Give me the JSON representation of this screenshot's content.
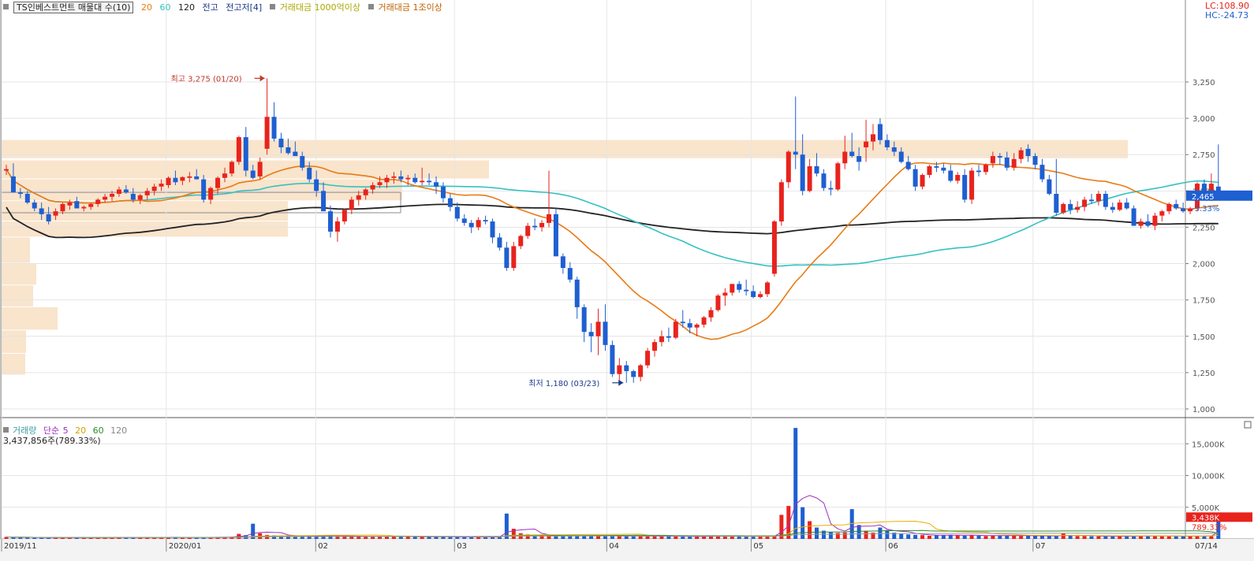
{
  "header": {
    "title": "TS인베스트먼트 매물대 수(10)",
    "ma_periods": [
      "20",
      "60",
      "120"
    ],
    "ma_colors": [
      "#e87b16",
      "#36c1c1",
      "#222222"
    ],
    "item_jeongo": "전고",
    "item_jeongojeo": "전고저[4]",
    "item_volume_1000": "거래대금 1000억이상",
    "item_volume_1jo": "거래대금 1조이상"
  },
  "corner": {
    "lc": "LC:108.90",
    "hc": "HC:-24.73"
  },
  "price_tag": {
    "value": "2,465",
    "change": "-3.33%"
  },
  "volume_tag": {
    "value": "3,438K",
    "change": "789.33%"
  },
  "annotations": {
    "high": "최고 3,275 (01/20)",
    "low": "최저 1,180 (03/23)"
  },
  "volume_legend": {
    "label": "거래량",
    "ma_type": "단순",
    "periods": [
      "5",
      "20",
      "60",
      "120"
    ],
    "current": "3,437,856주(789.33%)"
  },
  "colors": {
    "up": "#e8231d",
    "down": "#1e5fd1",
    "ma20": "#e87b16",
    "ma60": "#36c1c1",
    "ma120": "#222222",
    "zone": "#f9e4cc"
  },
  "chart_data": [
    {
      "type": "candlestick",
      "title": "TS인베스트먼트",
      "ylim": [
        1000,
        3400
      ],
      "y_ticks": [
        "3,250",
        "3,000",
        "2,750",
        "2,500",
        "2,250",
        "2,000",
        "1,750",
        "1,500",
        "1,250",
        "1,000"
      ],
      "x_ticks": [
        "2019/11",
        "2020/01",
        "02",
        "03",
        "04",
        "05",
        "06",
        "07",
        "07/14"
      ],
      "candles": [
        [
          2640,
          2680,
          2610,
          2650
        ],
        [
          2600,
          2690,
          2560,
          2490
        ],
        [
          2490,
          2520,
          2450,
          2480
        ],
        [
          2480,
          2500,
          2410,
          2420
        ],
        [
          2420,
          2440,
          2360,
          2380
        ],
        [
          2380,
          2420,
          2300,
          2340
        ],
        [
          2340,
          2390,
          2270,
          2290
        ],
        [
          2330,
          2380,
          2300,
          2360
        ],
        [
          2360,
          2420,
          2340,
          2410
        ],
        [
          2400,
          2440,
          2370,
          2420
        ],
        [
          2430,
          2460,
          2400,
          2380
        ],
        [
          2380,
          2400,
          2360,
          2390
        ],
        [
          2390,
          2420,
          2370,
          2410
        ],
        [
          2410,
          2450,
          2390,
          2440
        ],
        [
          2440,
          2480,
          2420,
          2460
        ],
        [
          2460,
          2500,
          2430,
          2480
        ],
        [
          2480,
          2530,
          2460,
          2510
        ],
        [
          2510,
          2540,
          2480,
          2490
        ],
        [
          2480,
          2520,
          2420,
          2440
        ],
        [
          2440,
          2480,
          2410,
          2470
        ],
        [
          2470,
          2520,
          2440,
          2500
        ],
        [
          2500,
          2550,
          2470,
          2530
        ],
        [
          2530,
          2580,
          2500,
          2550
        ],
        [
          2540,
          2600,
          2520,
          2590
        ],
        [
          2590,
          2640,
          2540,
          2560
        ],
        [
          2570,
          2600,
          2540,
          2595
        ],
        [
          2590,
          2630,
          2560,
          2600
        ],
        [
          2600,
          2650,
          2580,
          2580
        ],
        [
          2580,
          2610,
          2420,
          2440
        ],
        [
          2440,
          2530,
          2410,
          2520
        ],
        [
          2520,
          2600,
          2480,
          2590
        ],
        [
          2590,
          2660,
          2560,
          2620
        ],
        [
          2620,
          2710,
          2600,
          2700
        ],
        [
          2700,
          2880,
          2680,
          2870
        ],
        [
          2870,
          2940,
          2600,
          2640
        ],
        [
          2640,
          2680,
          2580,
          2590
        ],
        [
          2600,
          2730,
          2580,
          2700
        ],
        [
          2790,
          3275,
          2750,
          3010
        ],
        [
          3010,
          3110,
          2840,
          2860
        ],
        [
          2860,
          2900,
          2760,
          2800
        ],
        [
          2800,
          2860,
          2750,
          2760
        ],
        [
          2770,
          2840,
          2750,
          2740
        ],
        [
          2740,
          2770,
          2640,
          2660
        ],
        [
          2660,
          2700,
          2560,
          2580
        ],
        [
          2580,
          2640,
          2460,
          2500
        ],
        [
          2500,
          2560,
          2400,
          2360
        ],
        [
          2360,
          2400,
          2180,
          2220
        ],
        [
          2220,
          2320,
          2150,
          2290
        ],
        [
          2290,
          2380,
          2270,
          2370
        ],
        [
          2370,
          2460,
          2340,
          2440
        ],
        [
          2440,
          2500,
          2400,
          2470
        ],
        [
          2470,
          2520,
          2440,
          2510
        ],
        [
          2510,
          2560,
          2480,
          2540
        ],
        [
          2540,
          2600,
          2520,
          2560
        ],
        [
          2560,
          2610,
          2520,
          2590
        ],
        [
          2590,
          2630,
          2550,
          2600
        ],
        [
          2600,
          2640,
          2560,
          2580
        ],
        [
          2580,
          2610,
          2540,
          2590
        ],
        [
          2590,
          2620,
          2550,
          2560
        ],
        [
          2560,
          2660,
          2540,
          2570
        ],
        [
          2570,
          2620,
          2540,
          2560
        ],
        [
          2560,
          2600,
          2480,
          2530
        ],
        [
          2530,
          2560,
          2420,
          2450
        ],
        [
          2450,
          2480,
          2360,
          2390
        ],
        [
          2390,
          2420,
          2290,
          2310
        ],
        [
          2310,
          2340,
          2260,
          2280
        ],
        [
          2280,
          2300,
          2210,
          2250
        ],
        [
          2250,
          2320,
          2230,
          2300
        ],
        [
          2300,
          2330,
          2270,
          2290
        ],
        [
          2290,
          2310,
          2140,
          2180
        ],
        [
          2180,
          2210,
          2090,
          2110
        ],
        [
          2110,
          2150,
          1950,
          1970
        ],
        [
          1970,
          2150,
          1950,
          2120
        ],
        [
          2120,
          2200,
          2100,
          2190
        ],
        [
          2190,
          2280,
          2170,
          2260
        ],
        [
          2260,
          2310,
          2230,
          2250
        ],
        [
          2250,
          2300,
          2220,
          2280
        ],
        [
          2280,
          2640,
          2250,
          2340
        ],
        [
          2340,
          2380,
          2060,
          2050
        ],
        [
          2050,
          2070,
          1930,
          1970
        ],
        [
          1970,
          2010,
          1870,
          1890
        ],
        [
          1890,
          1910,
          1620,
          1700
        ],
        [
          1700,
          1720,
          1460,
          1530
        ],
        [
          1530,
          1590,
          1390,
          1500
        ],
        [
          1500,
          1690,
          1370,
          1600
        ],
        [
          1600,
          1720,
          1400,
          1440
        ],
        [
          1440,
          1470,
          1220,
          1240
        ],
        [
          1240,
          1350,
          1200,
          1300
        ],
        [
          1300,
          1330,
          1180,
          1260
        ],
        [
          1260,
          1270,
          1180,
          1220
        ],
        [
          1220,
          1310,
          1190,
          1300
        ],
        [
          1300,
          1420,
          1280,
          1400
        ],
        [
          1400,
          1480,
          1360,
          1460
        ],
        [
          1460,
          1540,
          1430,
          1500
        ],
        [
          1500,
          1560,
          1460,
          1490
        ],
        [
          1490,
          1620,
          1480,
          1600
        ],
        [
          1600,
          1680,
          1560,
          1590
        ],
        [
          1590,
          1620,
          1520,
          1560
        ],
        [
          1560,
          1590,
          1500,
          1580
        ],
        [
          1580,
          1640,
          1560,
          1630
        ],
        [
          1630,
          1700,
          1600,
          1680
        ],
        [
          1680,
          1790,
          1670,
          1780
        ],
        [
          1780,
          1830,
          1710,
          1800
        ],
        [
          1800,
          1860,
          1780,
          1860
        ],
        [
          1860,
          1880,
          1800,
          1820
        ],
        [
          1820,
          1890,
          1780,
          1810
        ],
        [
          1810,
          1850,
          1760,
          1770
        ],
        [
          1770,
          1810,
          1760,
          1790
        ],
        [
          1790,
          1880,
          1770,
          1870
        ],
        [
          1930,
          2300,
          1910,
          2290
        ],
        [
          2290,
          2580,
          2260,
          2560
        ],
        [
          2560,
          2780,
          2520,
          2770
        ],
        [
          2770,
          3150,
          2650,
          2750
        ],
        [
          2750,
          2890,
          2470,
          2500
        ],
        [
          2500,
          2720,
          2490,
          2670
        ],
        [
          2670,
          2760,
          2600,
          2620
        ],
        [
          2620,
          2650,
          2500,
          2520
        ],
        [
          2520,
          2570,
          2470,
          2510
        ],
        [
          2510,
          2700,
          2500,
          2690
        ],
        [
          2690,
          2880,
          2650,
          2770
        ],
        [
          2770,
          2900,
          2730,
          2740
        ],
        [
          2740,
          2800,
          2640,
          2700
        ],
        [
          2800,
          2990,
          2700,
          2840
        ],
        [
          2840,
          2960,
          2780,
          2890
        ],
        [
          2960,
          3000,
          2820,
          2850
        ],
        [
          2850,
          2890,
          2780,
          2800
        ],
        [
          2800,
          2840,
          2740,
          2770
        ],
        [
          2770,
          2800,
          2690,
          2700
        ],
        [
          2700,
          2740,
          2640,
          2650
        ],
        [
          2650,
          2680,
          2500,
          2530
        ],
        [
          2530,
          2620,
          2510,
          2610
        ],
        [
          2610,
          2680,
          2590,
          2670
        ],
        [
          2670,
          2700,
          2630,
          2660
        ],
        [
          2660,
          2690,
          2620,
          2640
        ],
        [
          2640,
          2680,
          2560,
          2570
        ],
        [
          2570,
          2630,
          2550,
          2610
        ],
        [
          2610,
          2650,
          2420,
          2440
        ],
        [
          2440,
          2660,
          2410,
          2640
        ],
        [
          2640,
          2680,
          2600,
          2630
        ],
        [
          2630,
          2690,
          2610,
          2680
        ],
        [
          2690,
          2770,
          2660,
          2740
        ],
        [
          2740,
          2760,
          2680,
          2730
        ],
        [
          2730,
          2770,
          2640,
          2660
        ],
        [
          2660,
          2760,
          2640,
          2720
        ],
        [
          2720,
          2800,
          2690,
          2780
        ],
        [
          2790,
          2820,
          2700,
          2740
        ],
        [
          2740,
          2760,
          2650,
          2680
        ],
        [
          2680,
          2720,
          2560,
          2580
        ],
        [
          2580,
          2610,
          2470,
          2480
        ],
        [
          2480,
          2720,
          2330,
          2350
        ],
        [
          2350,
          2420,
          2340,
          2410
        ],
        [
          2410,
          2440,
          2340,
          2370
        ],
        [
          2370,
          2430,
          2350,
          2390
        ],
        [
          2390,
          2460,
          2360,
          2440
        ],
        [
          2440,
          2480,
          2410,
          2430
        ],
        [
          2430,
          2500,
          2400,
          2480
        ],
        [
          2480,
          2500,
          2370,
          2390
        ],
        [
          2390,
          2420,
          2350,
          2370
        ],
        [
          2370,
          2440,
          2360,
          2420
        ],
        [
          2420,
          2450,
          2370,
          2380
        ],
        [
          2380,
          2400,
          2260,
          2260
        ],
        [
          2260,
          2310,
          2240,
          2290
        ],
        [
          2290,
          2340,
          2250,
          2260
        ],
        [
          2260,
          2350,
          2230,
          2330
        ],
        [
          2330,
          2370,
          2290,
          2360
        ],
        [
          2360,
          2420,
          2340,
          2410
        ],
        [
          2410,
          2440,
          2370,
          2380
        ],
        [
          2380,
          2420,
          2350,
          2360
        ],
        [
          2360,
          2390,
          2340,
          2380
        ],
        [
          2380,
          2560,
          2360,
          2550
        ],
        [
          2550,
          2580,
          2470,
          2490
        ],
        [
          2490,
          2620,
          2470,
          2550
        ],
        [
          2530,
          2820,
          2450,
          2465
        ]
      ],
      "volume_ylim": [
        0,
        18500
      ],
      "volume_ticks": [
        "15,000K",
        "10,000K",
        "5,000K"
      ],
      "volume": [
        320,
        260,
        240,
        200,
        220,
        210,
        250,
        230,
        210,
        220,
        200,
        180,
        190,
        220,
        260,
        240,
        260,
        230,
        240,
        220,
        250,
        260,
        240,
        280,
        250,
        230,
        210,
        240,
        300,
        260,
        280,
        300,
        350,
        800,
        600,
        2400,
        900,
        620,
        560,
        520,
        480,
        420,
        470,
        540,
        500,
        580,
        520,
        460,
        420,
        400,
        380,
        360,
        380,
        420,
        400,
        380,
        360,
        340,
        320,
        360,
        340,
        320,
        330,
        300,
        320,
        310,
        280,
        300,
        280,
        330,
        300,
        4000,
        1600,
        900,
        720,
        560,
        600,
        520,
        480,
        450,
        470,
        560,
        560,
        500,
        520,
        480,
        430,
        450,
        500,
        420,
        420,
        450,
        450,
        420,
        400,
        380,
        360,
        350,
        380,
        420,
        450,
        400,
        380,
        400,
        420,
        410,
        430,
        420,
        380,
        400,
        3800,
        5200,
        17500,
        5000,
        2800,
        1800,
        1300,
        1100,
        950,
        1000,
        4700,
        2200,
        1300,
        1000,
        1800,
        1400,
        1000,
        800,
        700,
        650,
        600,
        500,
        560,
        620,
        660,
        600,
        520,
        600,
        500,
        450,
        560,
        560,
        560,
        500,
        480,
        500,
        460,
        500,
        480,
        450,
        860,
        520,
        450,
        460,
        420,
        400,
        420,
        440,
        460,
        400,
        460,
        480,
        500,
        460,
        440,
        400,
        480,
        420,
        460,
        470,
        440,
        520,
        3438
      ]
    }
  ]
}
